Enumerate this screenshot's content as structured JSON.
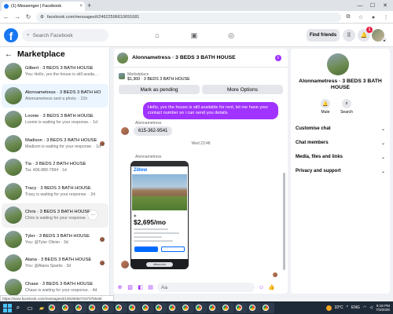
{
  "browser": {
    "tab_title": "(1) Messenger | Facebook",
    "url": "facebook.com/messages/t/24622596610691681"
  },
  "fb": {
    "search_placeholder": "Search Facebook",
    "find_friends": "Find friends",
    "notification_count": "1"
  },
  "sidebar": {
    "title": "Marketplace",
    "conversations": [
      {
        "name": "Gilbert · 3 BEDS 3 BATH HOUSE",
        "preview": "You: Hello, yes the house is still availa... · 1m"
      },
      {
        "name": "Alonnametress · 3 BEDS 3 BATH HOUSE",
        "preview": "Alonnametress sent a photo. · 21h"
      },
      {
        "name": "Loonie · 3 BEDS 3 BATH HOUSE",
        "preview": "Loonie is waiting for your response. · 1d"
      },
      {
        "name": "Madison · 3 BEDS 3 BATH HOUSE",
        "preview": "Madison is waiting for your response. · 1d"
      },
      {
        "name": "Tia · 3 BEDS 2 BATH HOUSE",
        "preview": "Tia: 406-880-7994 · 1d"
      },
      {
        "name": "Tracy · 3 BEDS 3 BATH HOUSE",
        "preview": "Tracy is waiting for your response. · 2d"
      },
      {
        "name": "Chris · 3 BEDS 3 BATH HOUSE",
        "preview": "Chris is waiting for your response. · 2d"
      },
      {
        "name": "Tyler · 3 BEDS 3 BATH HOUSE",
        "preview": "You: @Tyler Olivier · 3d"
      },
      {
        "name": "Alana · 3 BEDS 3 BATH HOUSE",
        "preview": "You: @Alana Sparks · 3d"
      },
      {
        "name": "Chase · 3 BEDS 3 BATH HOUSE",
        "preview": "Chase is waiting for your response. · 4d"
      }
    ]
  },
  "chat": {
    "header_name": "Alonnametress · 3 BEDS 3 BATH HOUSE",
    "marketplace_label": "Marketplace",
    "listing_price": "$1,300 · 3 BEDS 3 BATH HOUSE",
    "mark_pending": "Mark as pending",
    "more_options": "More Options",
    "messages": {
      "outgoing": "Hello, yes the house is still available for rent, let me have your contact number so i can send you details.",
      "incoming_sender": "Alonnametress",
      "incoming_text": "615-362-9541",
      "time_separator": "Wed 23:48",
      "photo_sender": "Alonnametress"
    },
    "zillow": {
      "brand": "Zillow",
      "price": "$2,695/mo",
      "url_label": "zillow.com"
    },
    "composer_placeholder": "Aa"
  },
  "details": {
    "name": "Alonnametress · 3 BEDS 3 BATH HOUSE",
    "mute": "Mute",
    "search": "Search",
    "rows": [
      "Customise chat",
      "Chat members",
      "Media, files and links",
      "Privacy and support"
    ]
  },
  "status_url": "https://www.facebook.com/messages/t/100200527237376546/",
  "taskbar": {
    "temperature": "33°C",
    "language": "ENG",
    "time": "9:19 PM",
    "date": "7/3/2025"
  }
}
